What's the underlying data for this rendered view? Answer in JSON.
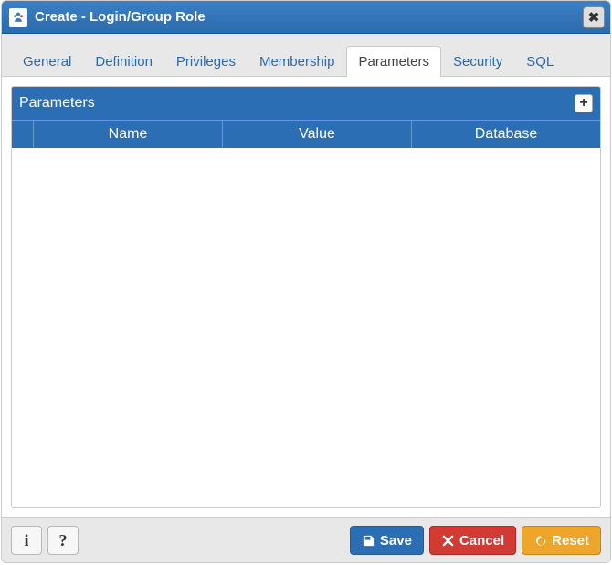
{
  "header": {
    "title": "Create - Login/Group Role"
  },
  "tabs": [
    {
      "label": "General",
      "active": false
    },
    {
      "label": "Definition",
      "active": false
    },
    {
      "label": "Privileges",
      "active": false
    },
    {
      "label": "Membership",
      "active": false
    },
    {
      "label": "Parameters",
      "active": true
    },
    {
      "label": "Security",
      "active": false
    },
    {
      "label": "SQL",
      "active": false
    }
  ],
  "panel": {
    "title": "Parameters",
    "columns": [
      "Name",
      "Value",
      "Database"
    ],
    "rows": []
  },
  "footer": {
    "info_label": "i",
    "help_label": "?",
    "save_label": "Save",
    "cancel_label": "Cancel",
    "reset_label": "Reset"
  }
}
